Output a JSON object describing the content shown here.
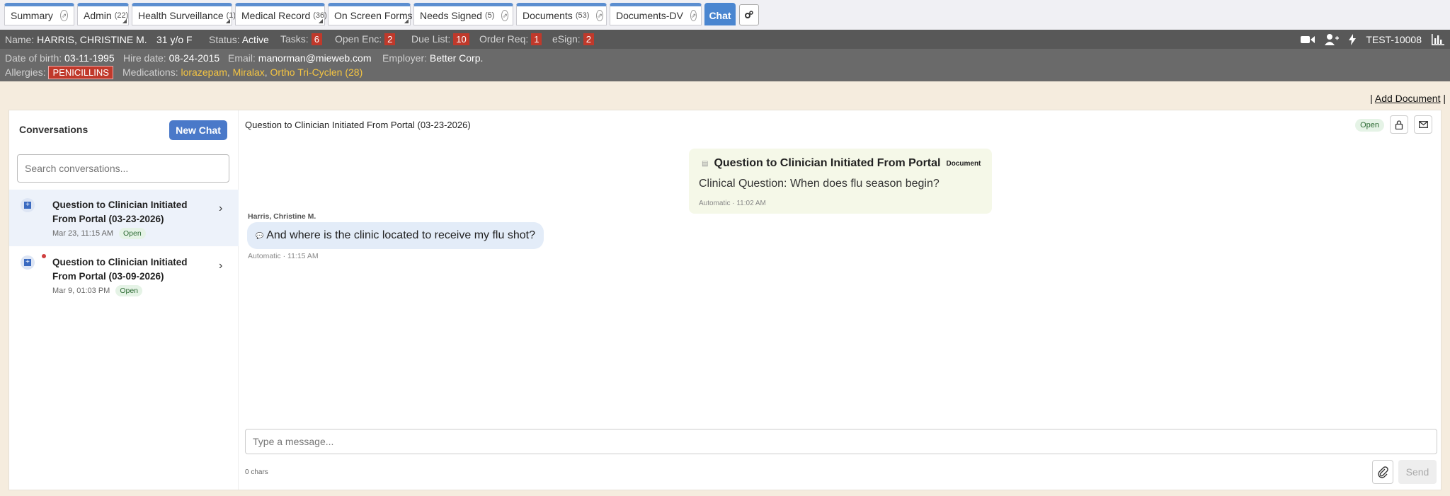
{
  "tabs": [
    {
      "label": "Summary",
      "count": "",
      "popout": true
    },
    {
      "label": "Admin",
      "count": "(22)",
      "popout": false
    },
    {
      "label": "Health Surveillance",
      "count": "(1)",
      "popout": false
    },
    {
      "label": "Medical Record",
      "count": "(36)",
      "popout": false
    },
    {
      "label": "On Screen Forms",
      "count": "",
      "popout": false
    },
    {
      "label": "Needs Signed",
      "count": "(5)",
      "popout": true
    },
    {
      "label": "Documents",
      "count": "(53)",
      "popout": true
    },
    {
      "label": "Documents-DV",
      "count": "",
      "popout": true
    },
    {
      "label": "Chat",
      "count": "",
      "popout": false
    }
  ],
  "patient": {
    "name_label": "Name:",
    "name": "HARRIS, CHRISTINE M.",
    "age_sex": "31 y/o F",
    "status_label": "Status:",
    "status": "Active",
    "tasks_label": "Tasks:",
    "tasks": "6",
    "open_enc_label": "Open Enc:",
    "open_enc": "2",
    "due_list_label": "Due List:",
    "due_list": "10",
    "order_req_label": "Order Req:",
    "order_req": "1",
    "esign_label": "eSign:",
    "esign": "2",
    "patient_id": "TEST-10008",
    "dob_label": "Date of birth:",
    "dob": "03-11-1995",
    "hire_label": "Hire date:",
    "hire_date": "08-24-2015",
    "email_label": "Email:",
    "email": "manorman@mieweb.com",
    "employer_label": "Employer:",
    "employer": "Better Corp.",
    "allergies_label": "Allergies:",
    "allergy": "PENICILLINS",
    "medications_label": "Medications:",
    "medications": [
      "lorazepam",
      "Miralax",
      "Ortho Tri-Cyclen (28)"
    ]
  },
  "add_document": "Add Document",
  "conversations": {
    "title": "Conversations",
    "new_chat": "New Chat",
    "search_placeholder": "Search conversations...",
    "items": [
      {
        "name": "Question to Clinician Initiated From Portal (03-23-2026)",
        "time": "Mar 23, 11:15 AM",
        "status": "Open",
        "unread": false
      },
      {
        "name": "Question to Clinician Initiated From Portal (03-09-2026)",
        "time": "Mar 9, 01:03 PM",
        "status": "Open",
        "unread": true
      }
    ]
  },
  "chat": {
    "title": "Question to Clinician Initiated From Portal (03-23-2026)",
    "status": "Open",
    "document": {
      "title": "Question to Clinician Initiated From Portal",
      "tag": "Document",
      "body": "Clinical Question: When does flu season begin?",
      "meta": "Automatic · 11:02 AM"
    },
    "message": {
      "sender": "Harris, Christine M.",
      "text": "And where is the clinic located to receive my flu shot?",
      "meta": "Automatic · 11:15 AM"
    },
    "compose_placeholder": "Type a message...",
    "chars": "0 chars",
    "send": "Send"
  },
  "colors": {
    "tab_accent": "#5b8ed0",
    "badge_red": "#c0392b",
    "medication": "#f5c542",
    "primary_button": "#4a79c9"
  }
}
